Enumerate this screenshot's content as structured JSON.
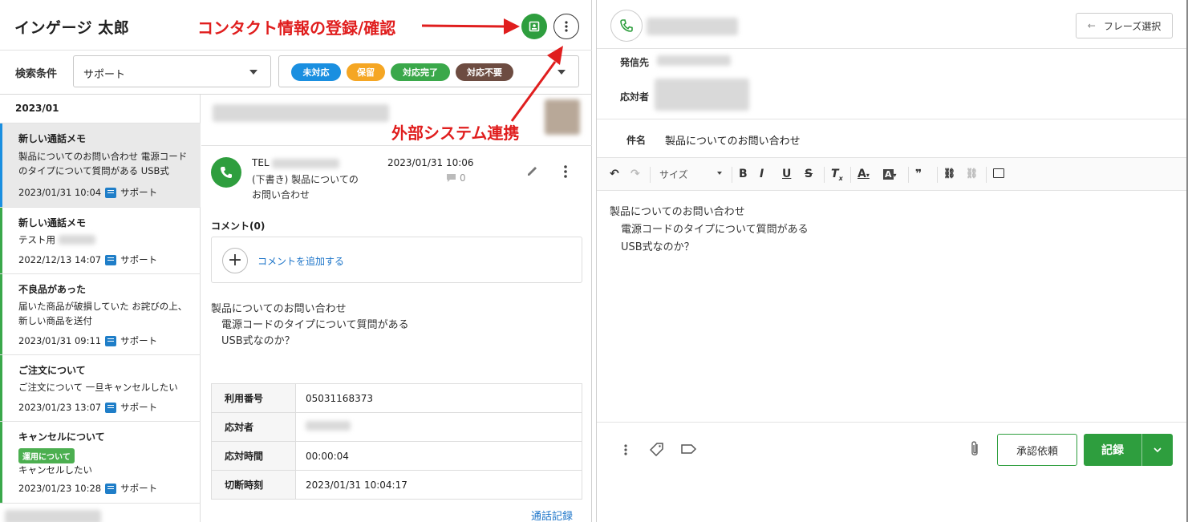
{
  "header": {
    "user_name": "インゲージ 太郎"
  },
  "annotations": {
    "contact_label": "コンタクト情報の登録/確認",
    "external_label": "外部システム連携"
  },
  "search": {
    "label": "検索条件",
    "selected": "サポート",
    "statuses": [
      {
        "label": "未対応",
        "color": "#1a8fe0"
      },
      {
        "label": "保留",
        "color": "#f5a623"
      },
      {
        "label": "対応完了",
        "color": "#3aa84a"
      },
      {
        "label": "対応不要",
        "color": "#6d4c41"
      }
    ]
  },
  "list": {
    "month": "2023/01",
    "items": [
      {
        "title": "新しい通話メモ",
        "desc": "製品についてのお問い合わせ 電源コードのタイプについて質問がある USB式",
        "date": "2023/01/31 10:04",
        "category": "サポート"
      },
      {
        "title": "新しい通話メモ",
        "desc": "テスト用",
        "date": "2022/12/13 14:07",
        "category": "サポート"
      },
      {
        "title": "不良品があった",
        "desc": "届いた商品が破損していた お詫びの上、新しい商品を送付",
        "date": "2023/01/31 09:11",
        "category": "サポート"
      },
      {
        "title": "ご注文について",
        "desc": "ご注文について 一旦キャンセルしたい",
        "date": "2023/01/23 13:07",
        "category": "サポート"
      },
      {
        "title": "キャンセルについて",
        "tag": "運用について",
        "desc": "キャンセルしたい",
        "date": "2023/01/23 10:28",
        "category": "サポート"
      }
    ]
  },
  "detail": {
    "tel_label": "TEL",
    "subject_prefix": "(下書き) 製品についての",
    "subject_rest": "お問い合わせ",
    "date": "2023/01/31 10:06",
    "comment_count": "0",
    "comments_heading": "コメント(0)",
    "add_comment": "コメントを追加する",
    "body": [
      "製品についてのお問い合わせ",
      "電源コードのタイプについて質問がある",
      "USB式なのか？"
    ],
    "info": [
      {
        "key": "利用番号",
        "value": "05031168373"
      },
      {
        "key": "応対者",
        "value": ""
      },
      {
        "key": "応対時間",
        "value": "00:00:04"
      },
      {
        "key": "切断時刻",
        "value": "2023/01/31 10:04:17"
      }
    ],
    "call_log": "通話記録"
  },
  "right": {
    "phrase_button": "フレーズ選択",
    "from_label": "発信先",
    "responder_label": "応対者",
    "subject_label": "件名",
    "subject_value": "製品についてのお問い合わせ",
    "font_size_label": "サイズ",
    "editor_lines": [
      "製品についてのお問い合わせ",
      "電源コードのタイプについて質問がある",
      "USB式なのか？"
    ],
    "approve_button": "承認依頼",
    "record_button": "記録"
  }
}
